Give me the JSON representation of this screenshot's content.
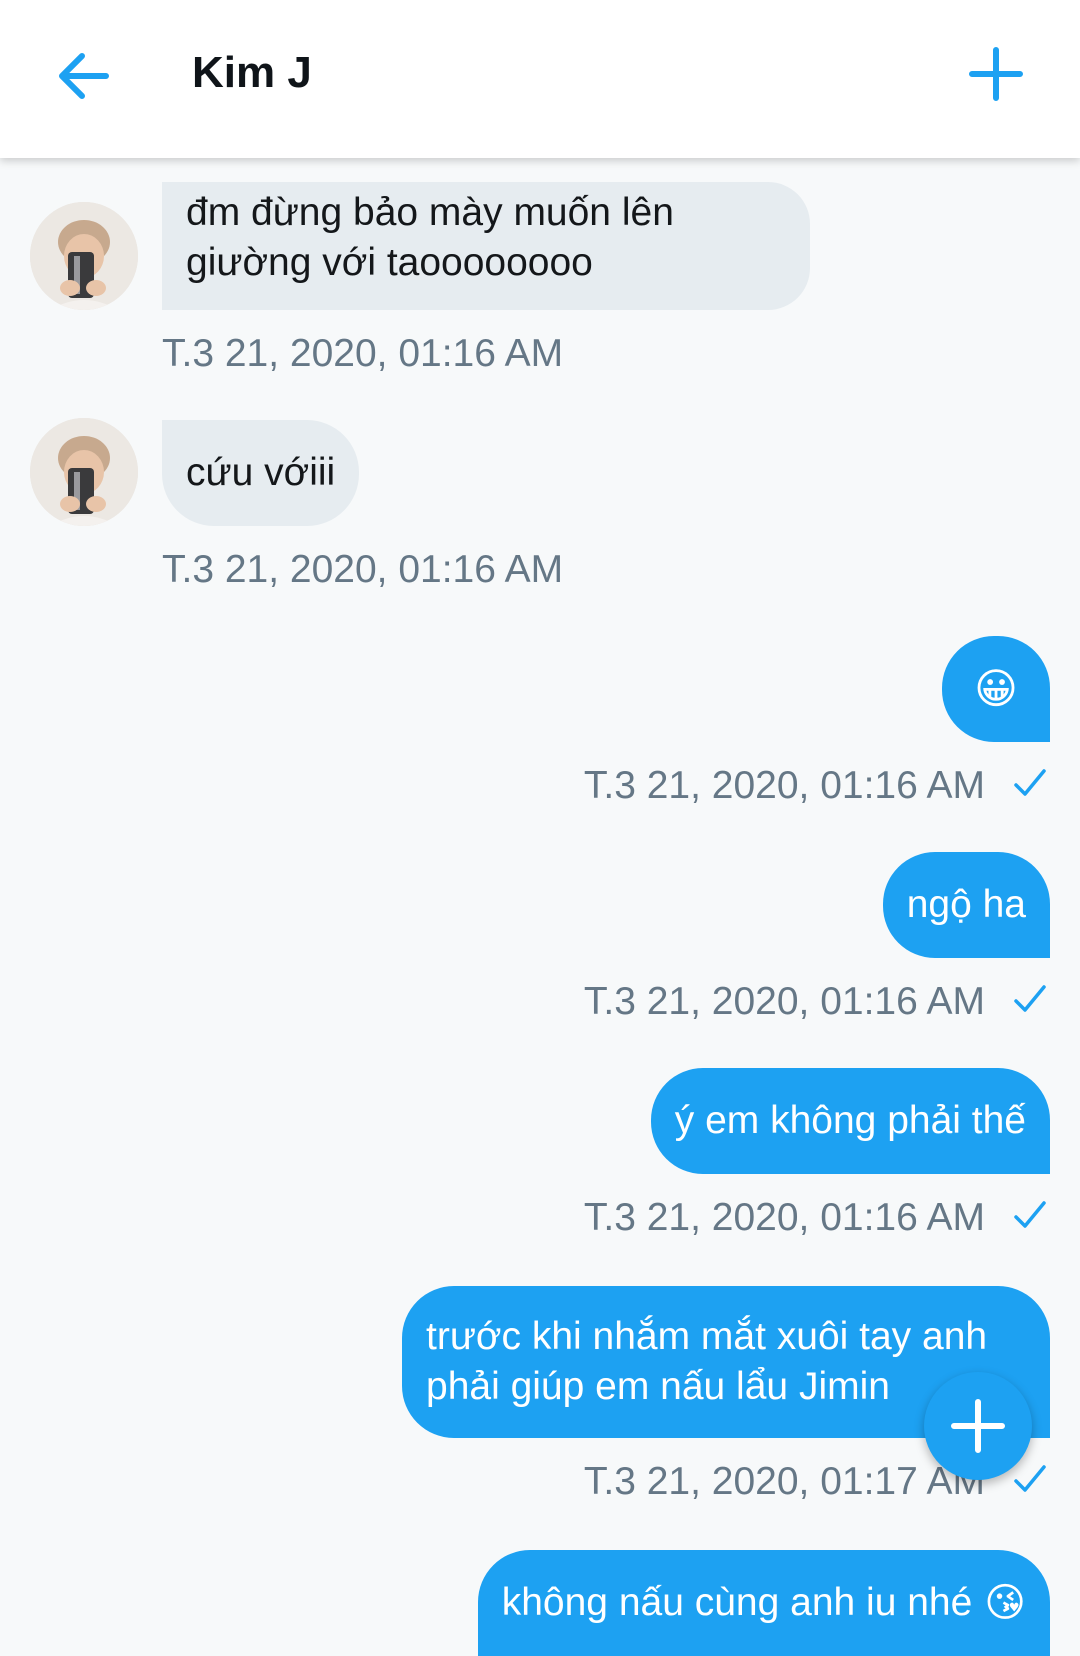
{
  "header": {
    "title": "Kim J"
  },
  "messages_in": [
    {
      "lines": [
        "đm đừng bảo mày muốn lên",
        "giường với taoooooooo"
      ],
      "time": "T.3 21, 2020, 01:16 AM"
    },
    {
      "text": "cứu vớiii",
      "time": "T.3 21, 2020, 01:16 AM"
    }
  ],
  "messages_out": [
    {
      "emoji": "😀",
      "time": "T.3 21, 2020, 01:16 AM"
    },
    {
      "text": "ngộ ha",
      "time": "T.3 21, 2020, 01:16 AM"
    },
    {
      "text": "ý em không phải thế",
      "time": "T.3 21, 2020, 01:16 AM"
    },
    {
      "lines": [
        "trước khi nhắm mắt xuôi tay anh",
        "phải giúp em nấu lẩu Jimin"
      ],
      "time": "T.3 21, 2020, 01:17 AM"
    },
    {
      "text": "không nấu cùng anh iu nhé",
      "emoji": "😘"
    }
  ],
  "icons": {
    "back": "arrow-left-icon",
    "add": "plus-icon",
    "sent": "check-icon",
    "compose": "plus-icon"
  },
  "colors": {
    "accent": "#1da1f2",
    "incoming_bubble": "#e6ecf0",
    "timestamp": "#657786"
  }
}
